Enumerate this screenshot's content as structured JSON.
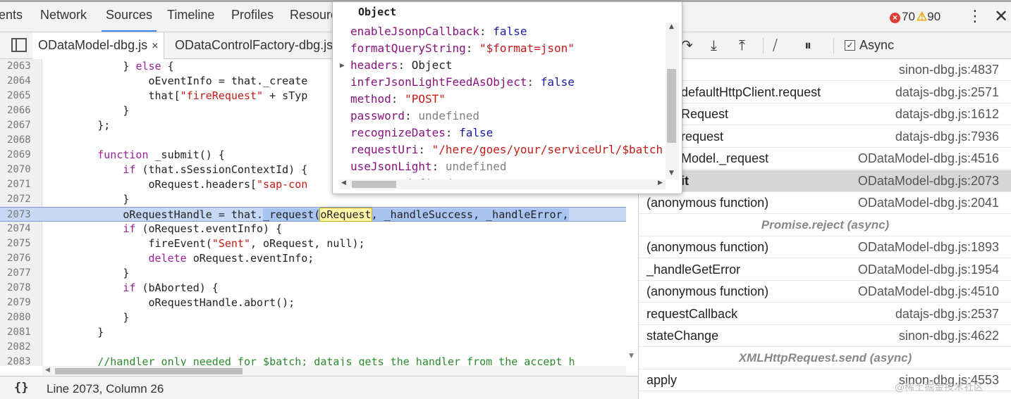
{
  "top_tabs": [
    "ents",
    "Network",
    "Sources",
    "Timeline",
    "Profiles",
    "Resourc"
  ],
  "top_tab_active": "Sources",
  "errors": "70",
  "warnings": "90",
  "file_tabs": [
    {
      "label": "ODataModel-dbg.js",
      "close": "×"
    },
    {
      "label": "ODataControlFactory-dbg.js"
    }
  ],
  "code_lines": [
    {
      "num": "2063",
      "segs": [
        {
          "t": "            } "
        },
        {
          "t": "else",
          "c": "kw"
        },
        {
          "t": " {"
        }
      ]
    },
    {
      "num": "2064",
      "segs": [
        {
          "t": "                oEventInfo = that._create"
        }
      ]
    },
    {
      "num": "2065",
      "segs": [
        {
          "t": "                that["
        },
        {
          "t": "\"fireRequest\"",
          "c": "str"
        },
        {
          "t": " + sTyp"
        }
      ]
    },
    {
      "num": "2066",
      "segs": [
        {
          "t": "            }"
        }
      ]
    },
    {
      "num": "2067",
      "segs": [
        {
          "t": "        };"
        }
      ]
    },
    {
      "num": "2068",
      "segs": [
        {
          "t": ""
        }
      ]
    },
    {
      "num": "2069",
      "segs": [
        {
          "t": "        "
        },
        {
          "t": "function",
          "c": "kw"
        },
        {
          "t": " _submit() {"
        }
      ]
    },
    {
      "num": "2070",
      "segs": [
        {
          "t": "            "
        },
        {
          "t": "if",
          "c": "kw"
        },
        {
          "t": " (that.sSessionContextId) {"
        }
      ]
    },
    {
      "num": "2071",
      "segs": [
        {
          "t": "                oRequest.headers["
        },
        {
          "t": "\"sap-con",
          "c": "str"
        }
      ]
    },
    {
      "num": "2072",
      "segs": [
        {
          "t": "            }"
        }
      ]
    },
    {
      "num": "2073",
      "hl": true,
      "segs": [
        {
          "t": "            oRequestHandle = that."
        },
        {
          "t": "_request(",
          "c": "sel"
        },
        {
          "t": "oRequest",
          "c": "tok"
        },
        {
          "t": ", _handleSuccess, _handleError,",
          "c": "sel"
        }
      ]
    },
    {
      "num": "2074",
      "segs": [
        {
          "t": "            "
        },
        {
          "t": "if",
          "c": "kw"
        },
        {
          "t": " (oRequest.eventInfo) {"
        }
      ]
    },
    {
      "num": "2075",
      "segs": [
        {
          "t": "                fireEvent("
        },
        {
          "t": "\"Sent\"",
          "c": "str"
        },
        {
          "t": ", oRequest, null);"
        }
      ]
    },
    {
      "num": "2076",
      "segs": [
        {
          "t": "                "
        },
        {
          "t": "delete",
          "c": "kw"
        },
        {
          "t": " oRequest.eventInfo;"
        }
      ]
    },
    {
      "num": "2077",
      "segs": [
        {
          "t": "            }"
        }
      ]
    },
    {
      "num": "2078",
      "segs": [
        {
          "t": "            "
        },
        {
          "t": "if",
          "c": "kw"
        },
        {
          "t": " (bAborted) {"
        }
      ]
    },
    {
      "num": "2079",
      "segs": [
        {
          "t": "                oRequestHandle.abort();"
        }
      ]
    },
    {
      "num": "2080",
      "segs": [
        {
          "t": "            }"
        }
      ]
    },
    {
      "num": "2081",
      "segs": [
        {
          "t": "        }"
        }
      ]
    },
    {
      "num": "2082",
      "segs": [
        {
          "t": ""
        }
      ]
    },
    {
      "num": "2083",
      "segs": [
        {
          "t": "        //handler only needed for $batch; datajs gets the handler from the accept h",
          "c": "cmt"
        }
      ]
    }
  ],
  "status": {
    "braces": "{}",
    "position": "Line 2073, Column 26"
  },
  "popover": {
    "title": "Object",
    "props": [
      {
        "key": "enableJsonpCallback",
        "val": "false",
        "vt": "kw"
      },
      {
        "key": "formatQueryString",
        "val": "\"$format=json\"",
        "vt": "str"
      },
      {
        "key": "headers",
        "val": "Object",
        "vt": "obj",
        "expandable": true
      },
      {
        "key": "inferJsonLightFeedAsObject",
        "val": "false",
        "vt": "kw"
      },
      {
        "key": "method",
        "val": "\"POST\"",
        "vt": "str"
      },
      {
        "key": "password",
        "val": "undefined",
        "vt": "undef"
      },
      {
        "key": "recognizeDates",
        "val": "false",
        "vt": "kw"
      },
      {
        "key": "requestUri",
        "val": "\"/here/goes/your/serviceUrl/$batch",
        "vt": "str"
      },
      {
        "key": "useJsonLight",
        "val": "undefined",
        "vt": "undef"
      },
      {
        "key": "user",
        "val": "undefined",
        "vt": "undef"
      }
    ]
  },
  "async_label": "Async",
  "call_stack": [
    {
      "fn": "",
      "loc": "sinon-dbg.js:4837"
    },
    {
      "fn": "defaultHttpClient.request",
      "loc": "datajs-dbg.js:2571"
    },
    {
      "fn": "Request",
      "loc": "datajs-dbg.js:1612"
    },
    {
      "fn": "request",
      "loc": "datajs-dbg.js:7936"
    },
    {
      "fn": "Model._request",
      "loc": "ODataModel-dbg.js:4516"
    },
    {
      "fn": "it",
      "loc": "ODataModel-dbg.js:2073",
      "selected": true
    },
    {
      "fn": "(anonymous function)",
      "loc": "ODataModel-dbg.js:2041"
    },
    {
      "async": "Promise.reject (async)"
    },
    {
      "fn": "(anonymous function)",
      "loc": "ODataModel-dbg.js:1893"
    },
    {
      "fn": "_handleGetError",
      "loc": "ODataModel-dbg.js:1954"
    },
    {
      "fn": "(anonymous function)",
      "loc": "ODataModel-dbg.js:4510"
    },
    {
      "fn": "requestCallback",
      "loc": "datajs-dbg.js:2537"
    },
    {
      "fn": "stateChange",
      "loc": "sinon-dbg.js:4622"
    },
    {
      "async": "XMLHttpRequest.send (async)"
    },
    {
      "fn": "apply",
      "loc": "sinon-dbg.js:4553"
    }
  ],
  "watermark": "@稀土掘金技术社区"
}
